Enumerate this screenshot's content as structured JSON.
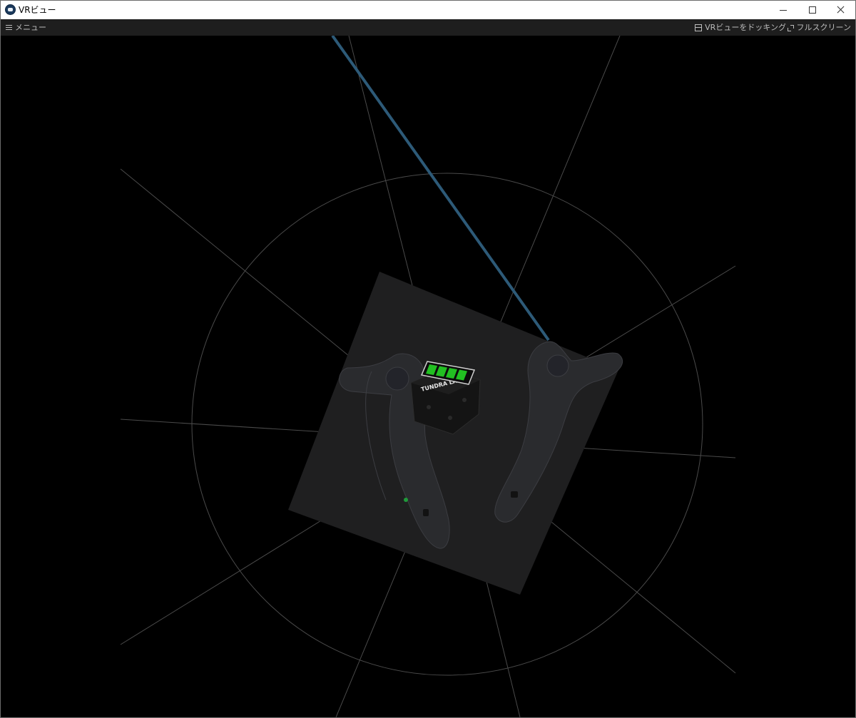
{
  "window": {
    "title": "VRビュー",
    "icon": "vr-view-app-icon",
    "controls": [
      "minimize-icon",
      "maximize-icon",
      "close-icon"
    ]
  },
  "toolbar": {
    "menu_label": "メニュー",
    "menu_icon": "hamburger-icon",
    "dock_label": "VRビューをドッキング",
    "dock_icon": "dock-icon",
    "fullscreen_label": "フルスクリーン",
    "fullscreen_icon": "fullscreen-icon"
  },
  "scene": {
    "background": "#000000",
    "floor_color": "#1f1f20",
    "grid_color": "#4a4a4a",
    "laser_color": "#2d5a78",
    "controller_color": "#2a2b2e",
    "battery_color": "#22c022",
    "battery_level": 1.0,
    "tracker_logo_text": "TUNDRA LABS"
  }
}
